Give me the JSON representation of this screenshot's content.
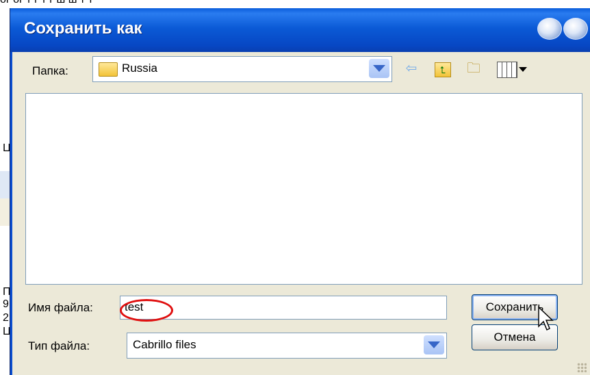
{
  "dialog": {
    "title": "Сохранить как",
    "folder_label": "Папка:",
    "folder_value": "Russia",
    "filename_label": "Имя файла:",
    "filename_value": "test",
    "filetype_label": "Тип файла:",
    "filetype_value": "Cabrillo files",
    "save_label": "Сохранить",
    "cancel_label": "Отмена"
  },
  "toolbar_icons": [
    "back-icon",
    "up-folder-icon",
    "new-folder-icon",
    "view-menu-icon"
  ],
  "colors": {
    "titlebar": "#0b5ad6",
    "dialog_bg": "#ece9d8",
    "highlight_circle": "#e01010"
  }
}
